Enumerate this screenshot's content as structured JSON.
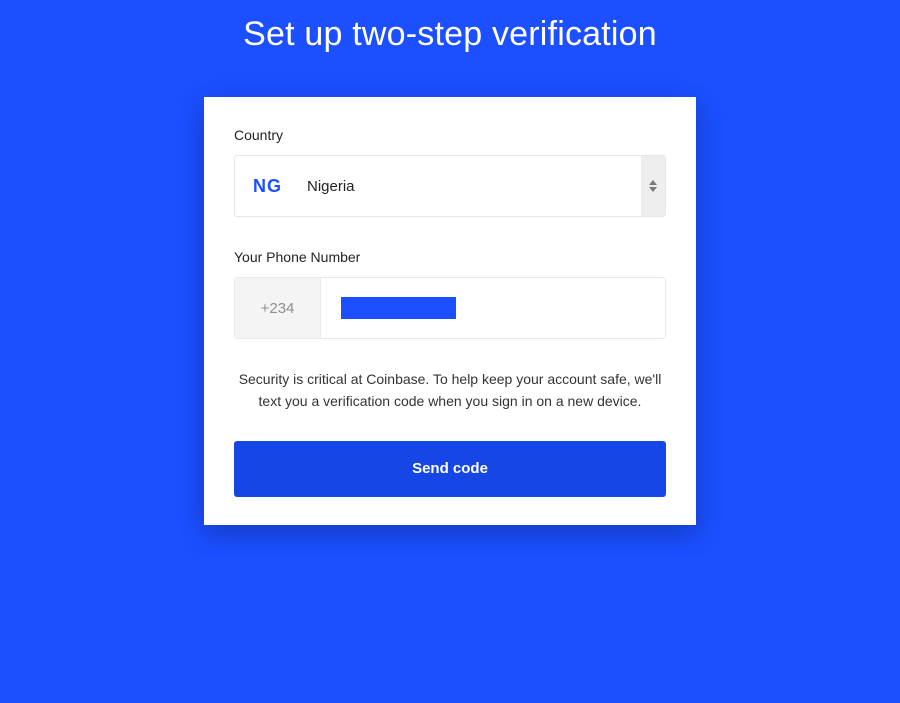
{
  "title": "Set up two-step verification",
  "country": {
    "label": "Country",
    "code": "NG",
    "name": "Nigeria"
  },
  "phone": {
    "label": "Your Phone Number",
    "dial_code": "+234"
  },
  "info": "Security is critical at Coinbase. To help keep your account safe, we'll text you a verification code when you sign in on a new device.",
  "cta": "Send code"
}
